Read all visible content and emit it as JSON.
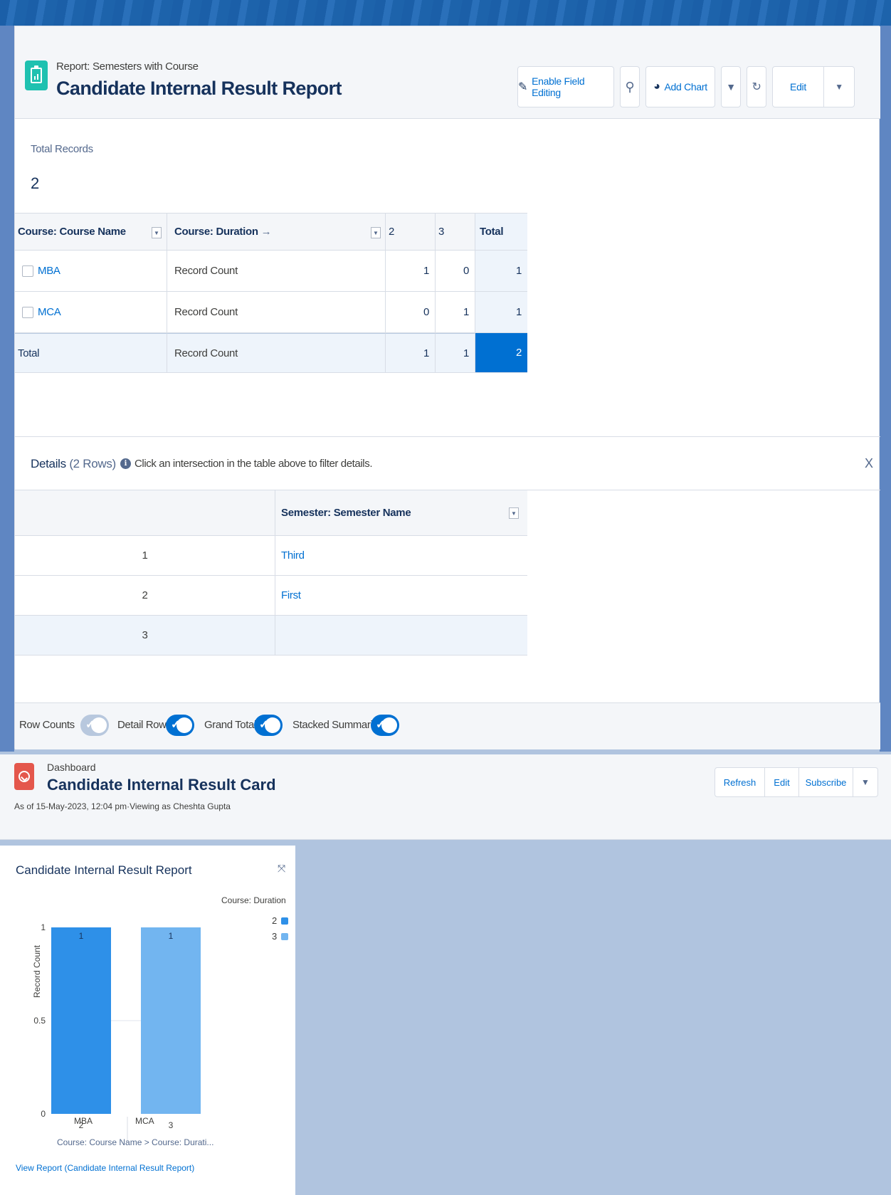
{
  "report": {
    "subtitle": "Report: Semesters with Course",
    "title": "Candidate Internal Result Report",
    "buttons": {
      "enable_field_editing": "Enable Field Editing",
      "add_chart": "Add Chart",
      "edit": "Edit"
    },
    "total_records_label": "Total Records",
    "total_records_value": "2",
    "matrix": {
      "headers": [
        "Course: Course Name",
        "Course: Duration",
        "2",
        "3",
        "Total"
      ],
      "duration_arrow": "→",
      "rows": [
        {
          "name": "MBA",
          "metric": "Record Count",
          "v2": "1",
          "v3": "0",
          "total": "1"
        },
        {
          "name": "MCA",
          "metric": "Record Count",
          "v2": "0",
          "v3": "1",
          "total": "1"
        },
        {
          "name": "Total",
          "metric": "Record Count",
          "v2": "1",
          "v3": "1",
          "total": "2"
        }
      ]
    },
    "details": {
      "title": "Details",
      "rows_note": "(2 Rows)",
      "info": "Click an intersection in the table above to filter details.",
      "close": "X",
      "column": "Semester: Semester Name",
      "rows": [
        {
          "num": "1",
          "value": "Third"
        },
        {
          "num": "2",
          "value": "First"
        },
        {
          "num": "3",
          "value": ""
        }
      ]
    },
    "toggles": [
      {
        "label": "Row Counts",
        "on": false
      },
      {
        "label": "Detail Rows",
        "on": true
      },
      {
        "label": "Grand Total",
        "on": true
      },
      {
        "label": "Stacked Summaries",
        "on": true
      }
    ]
  },
  "dashboard": {
    "subtitle": "Dashboard",
    "title": "Candidate Internal Result Card",
    "as_of": "As of 15-May-2023, 12:04 pm·Viewing as Cheshta Gupta",
    "buttons": {
      "refresh": "Refresh",
      "edit": "Edit",
      "subscribe": "Subscribe"
    },
    "widget_title": "Candidate Internal Result Report",
    "view_report": "View Report (Candidate Internal Result Report)"
  },
  "chart_data": {
    "type": "bar",
    "title": "Candidate Internal Result Report",
    "ylabel": "Record Count",
    "xlabel": "Course: Course Name > Course: Durati...",
    "ylim": [
      0,
      1
    ],
    "yticks": [
      "0",
      "0.5",
      "1"
    ],
    "legend_title": "Course: Duration",
    "legend_position": "top-right",
    "groups": [
      {
        "group": "MBA",
        "category": "2",
        "series": "2",
        "value": 1
      },
      {
        "group": "MCA",
        "category": "3",
        "series": "3",
        "value": 1
      }
    ],
    "series": [
      {
        "name": "2",
        "color": "#2e90e8"
      },
      {
        "name": "3",
        "color": "#72b5f0"
      }
    ]
  },
  "colors": {
    "accent": "#0070d2",
    "report_icon": "#1fc1b0",
    "dashboard_icon": "#e4574c"
  }
}
